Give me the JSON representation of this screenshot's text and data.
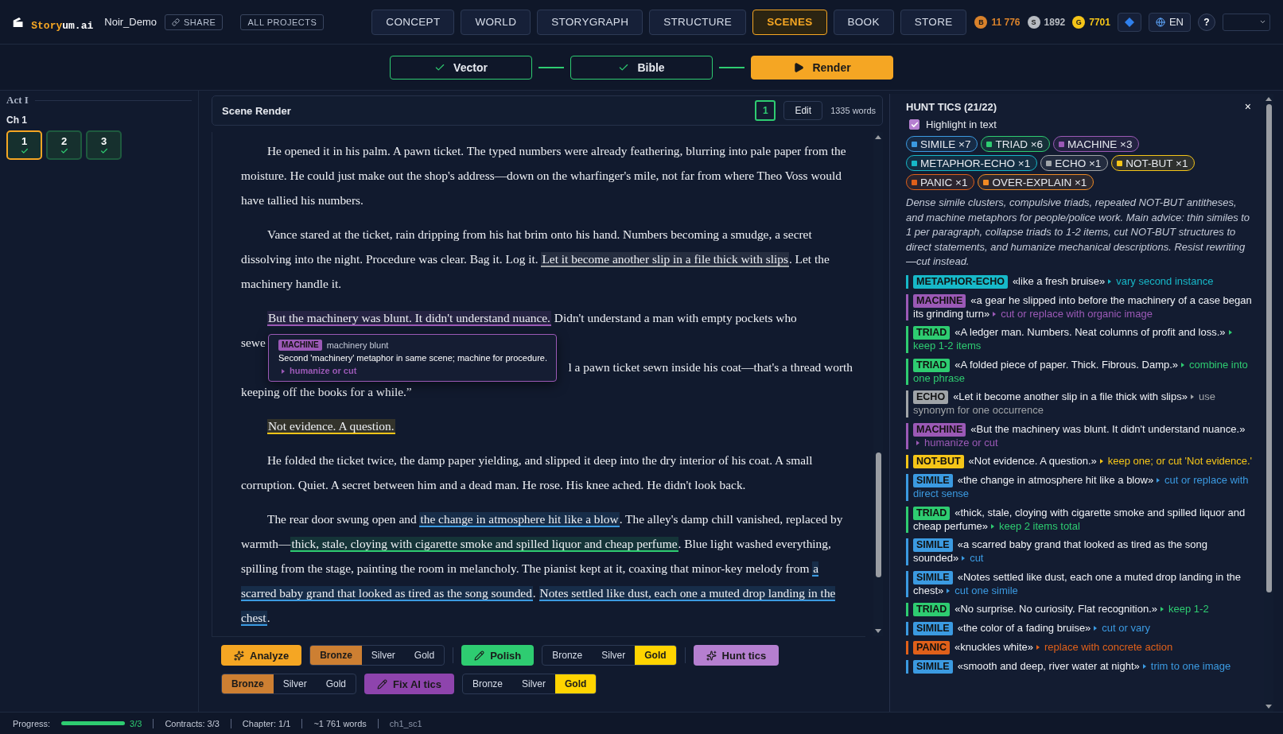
{
  "header": {
    "brand_accent": "Story",
    "brand_rest": "um.ai",
    "project": "Noir_Demo",
    "share": "SHARE",
    "all_projects": "ALL PROJECTS",
    "nav": [
      {
        "label": "CONCEPT",
        "selected": false
      },
      {
        "label": "WORLD",
        "selected": false
      },
      {
        "label": "STORYGRAPH",
        "selected": false
      },
      {
        "label": "STRUCTURE",
        "selected": false
      },
      {
        "label": "SCENES",
        "selected": true
      },
      {
        "label": "BOOK",
        "selected": false
      },
      {
        "label": "STORE",
        "selected": false
      }
    ],
    "currencies": [
      {
        "letter": "B",
        "value": "11 776",
        "color": "#d9822b"
      },
      {
        "letter": "S",
        "value": "1892",
        "color": "#b8bcc2"
      },
      {
        "letter": "G",
        "value": "7701",
        "color": "#f5c518"
      }
    ],
    "lang": "EN",
    "help": "?"
  },
  "pipeline": [
    {
      "label": "Vector",
      "done": true,
      "selected": false
    },
    {
      "label": "Bible",
      "done": true,
      "selected": false
    },
    {
      "label": "Render",
      "done": false,
      "selected": true
    }
  ],
  "sidebar": {
    "act": "Act I",
    "chapter": "Ch 1",
    "scenes": [
      {
        "label": "1",
        "selected": true,
        "done": true
      },
      {
        "label": "2",
        "selected": false,
        "done": true
      },
      {
        "label": "3",
        "selected": false,
        "done": true
      }
    ]
  },
  "scene": {
    "title": "Scene Render",
    "version": "1",
    "edit": "Edit",
    "words": "1335 words",
    "paragraphs": [
      {
        "segments": [
          {
            "text": "He opened it in his palm. A pawn ticket. The typed numbers were already feathering, blurring into pale paper from the moisture. He could just make out the shop's address—down on the wharfinger's mile, not far from where Theo Voss would have tallied his numbers."
          }
        ]
      },
      {
        "segments": [
          {
            "text": "Vance stared at the ticket, rain dripping from his hat brim onto his hand. Numbers becoming a smudge, a secret dissolving into the night. Procedure was clear. Bag it. Log it. "
          },
          {
            "text": "Let it become another slip in a file thick with slips",
            "color": "#a0a4a8"
          },
          {
            "text": ". Let the machinery handle it."
          }
        ]
      },
      {
        "lines": [
          [
            {
              "text": "But the machinery was blunt. It didn't understand nuance.",
              "color": "#9b59b6"
            },
            {
              "text": " Didn't understand a man with empty pockets who"
            }
          ],
          [
            {
              "text": "sewe"
            }
          ],
          [
            {
              "text": "l a pawn ticket sewn inside his coat—that's a thread worth"
            }
          ],
          [
            {
              "text": "keeping off the books for a while.”"
            }
          ]
        ]
      },
      {
        "segments": [
          {
            "text": "Not evidence. A question.",
            "color": "#f5c518"
          }
        ]
      },
      {
        "segments": [
          {
            "text": "He folded the ticket twice, the damp paper yielding, and slipped it deep into the dry interior of his coat. A small corruption. Quiet. A secret between him and a dead man. He rose. His knee ached. He didn't look back."
          }
        ]
      },
      {
        "segments": [
          {
            "text": "The rear door swung open and "
          },
          {
            "text": "the change in atmosphere hit like a blow",
            "color": "#3b9ae1"
          },
          {
            "text": ". The alley's damp chill vanished, replaced by warmth—"
          },
          {
            "text": "thick, stale, cloying with cigarette smoke and spilled liquor and cheap perfume",
            "color": "#2ecc71"
          },
          {
            "text": ". Blue light washed everything, spilling from the stage, painting the room in melancholy. The pianist kept at it, coaxing that minor-key melody from "
          },
          {
            "text": "a scarred baby grand that looked as tired as the song sounded",
            "color": "#3b9ae1"
          },
          {
            "text": ". "
          },
          {
            "text": "Notes settled like dust, each one a muted drop landing in the chest",
            "color": "#3b9ae1"
          },
          {
            "text": "."
          }
        ]
      }
    ],
    "tooltip": {
      "tag": "MACHINE",
      "title": "machinery blunt",
      "body": "Second 'machinery' metaphor in same scene; machine for procedure.",
      "advice": "humanize or cut",
      "color": "#9b59b6"
    }
  },
  "toolbar": [
    [
      {
        "kind": "sparkle-action",
        "label": "Analyze",
        "color": "#f5a623"
      },
      {
        "kind": "tiers",
        "options": [
          {
            "label": "Bronze",
            "selected": true
          },
          {
            "label": "Silver",
            "selected": false
          },
          {
            "label": "Gold",
            "selected": false
          }
        ]
      },
      {
        "kind": "divider"
      },
      {
        "kind": "edit-action",
        "label": "Polish",
        "color": "#2ecc71"
      },
      {
        "kind": "tiers",
        "options": [
          {
            "label": "Bronze",
            "selected": false
          },
          {
            "label": "Silver",
            "selected": false
          },
          {
            "label": "Gold",
            "selected": true
          }
        ]
      },
      {
        "kind": "divider"
      },
      {
        "kind": "sparkle-action",
        "label": "Hunt tics",
        "color": "#b57fd0"
      }
    ],
    [
      {
        "kind": "tiers",
        "options": [
          {
            "label": "Bronze",
            "selected": true
          },
          {
            "label": "Silver",
            "selected": false
          },
          {
            "label": "Gold",
            "selected": false
          }
        ]
      },
      {
        "kind": "edit-action",
        "label": "Fix AI tics",
        "color": "#8e44ad"
      },
      {
        "kind": "tiers",
        "options": [
          {
            "label": "Bronze",
            "selected": false
          },
          {
            "label": "Silver",
            "selected": false
          },
          {
            "label": "Gold",
            "selected": true
          }
        ]
      }
    ]
  ],
  "tics_panel": {
    "title": "HUNT TICS (21/22)",
    "close": "×",
    "highlight": {
      "label": "Highlight in text",
      "checked": true
    },
    "chips": [
      {
        "label": "SIMILE ×7",
        "color": "#3b9ae1"
      },
      {
        "label": "TRIAD ×6",
        "color": "#2ecc71"
      },
      {
        "label": "MACHINE ×3",
        "color": "#9b59b6"
      },
      {
        "label": "METAPHOR-ECHO ×1",
        "color": "#17b8c8"
      },
      {
        "label": "ECHO ×1",
        "color": "#a0a4a8"
      },
      {
        "label": "NOT-BUT ×1",
        "color": "#f5c518"
      },
      {
        "label": "PANIC ×1",
        "color": "#e0601a"
      },
      {
        "label": "OVER-EXPLAIN ×1",
        "color": "#f08a24"
      }
    ],
    "summary": "Dense simile clusters, compulsive triads, repeated NOT-BUT antitheses, and machine metaphors for people/police work. Main advice: thin similes to 1 per paragraph, collapse triads to 1-2 items, cut NOT-BUT structures to direct statements, and humanize mechanical descriptions. Resist rewriting—cut instead.",
    "items": [
      {
        "tag": "METAPHOR-ECHO",
        "quote": "«like a fresh bruise»",
        "advice": "vary second instance",
        "color": "#17b8c8"
      },
      {
        "tag": "MACHINE",
        "quote": "«a gear he slipped into before the machinery of a case began its grinding turn»",
        "advice": "cut or replace with organic image",
        "color": "#9b59b6"
      },
      {
        "tag": "TRIAD",
        "quote": "«A ledger man. Numbers. Neat columns of profit and loss.»",
        "advice": "keep 1-2 items",
        "color": "#2ecc71"
      },
      {
        "tag": "TRIAD",
        "quote": "«A folded piece of paper. Thick. Fibrous. Damp.»",
        "advice": "combine into one phrase",
        "color": "#2ecc71"
      },
      {
        "tag": "ECHO",
        "quote": "«Let it become another slip in a file thick with slips»",
        "advice": "use synonym for one occurrence",
        "color": "#a0a4a8"
      },
      {
        "tag": "MACHINE",
        "quote": "«But the machinery was blunt. It didn't understand nuance.»",
        "advice": "humanize or cut",
        "color": "#9b59b6"
      },
      {
        "tag": "NOT-BUT",
        "quote": "«Not evidence. A question.»",
        "advice": "keep one; or cut 'Not evidence.'",
        "color": "#f5c518"
      },
      {
        "tag": "SIMILE",
        "quote": "«the change in atmosphere hit like a blow»",
        "advice": "cut or replace with direct sense",
        "color": "#3b9ae1"
      },
      {
        "tag": "TRIAD",
        "quote": "«thick, stale, cloying with cigarette smoke and spilled liquor and cheap perfume»",
        "advice": "keep 2 items total",
        "color": "#2ecc71"
      },
      {
        "tag": "SIMILE",
        "quote": "«a scarred baby grand that looked as tired as the song sounded»",
        "advice": "cut",
        "color": "#3b9ae1"
      },
      {
        "tag": "SIMILE",
        "quote": "«Notes settled like dust, each one a muted drop landing in the chest»",
        "advice": "cut one simile",
        "color": "#3b9ae1"
      },
      {
        "tag": "TRIAD",
        "quote": "«No surprise. No curiosity. Flat recognition.»",
        "advice": "keep 1-2",
        "color": "#2ecc71"
      },
      {
        "tag": "SIMILE",
        "quote": "«the color of a fading bruise»",
        "advice": "cut or vary",
        "color": "#3b9ae1"
      },
      {
        "tag": "PANIC",
        "quote": "«knuckles white»",
        "advice": "replace with concrete action",
        "color": "#e0601a"
      },
      {
        "tag": "SIMILE",
        "quote": "«smooth and deep, river water at night»",
        "advice": "trim to one image",
        "color": "#3b9ae1"
      }
    ]
  },
  "status_bar": {
    "progress_label": "Progress:",
    "progress": {
      "level": 1,
      "reading": "3/3"
    },
    "contracts": "Contracts: 3/3",
    "chapter": "Chapter: 1/1",
    "words": "~1 761 words",
    "scene_id": "ch1_sc1"
  }
}
